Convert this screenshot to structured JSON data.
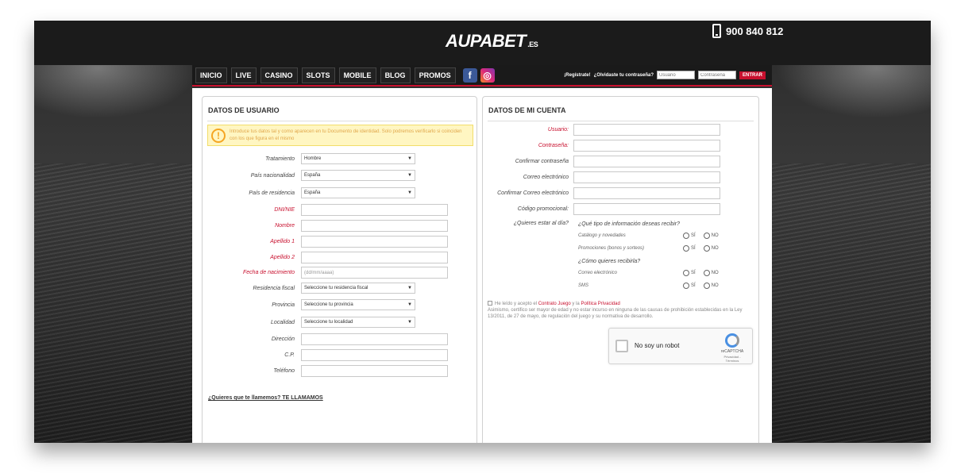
{
  "header": {
    "logo_text": "AUPABET",
    "logo_suffix": ".ES",
    "phone": "900 840 812"
  },
  "nav": {
    "items": [
      "INICIO",
      "LIVE",
      "CASINO",
      "SLOTS",
      "MOBILE",
      "BLOG",
      "PROMOS"
    ],
    "register_link": "¡Regístrate!",
    "forgot_link": "¿Olvidaste tu contraseña?",
    "username_placeholder": "Usuario",
    "password_placeholder": "Contraseña",
    "login_button": "ENTRAR"
  },
  "user_panel": {
    "title": "DATOS DE USUARIO",
    "warning": "Introduce tus datos tal y como aparecen en tu Documento de identidad. Solo podremos verificarlo si coinciden con los que figura en el mismo",
    "fields": [
      {
        "label": "Tratamiento",
        "type": "select",
        "value": "Hombre",
        "required": false
      },
      {
        "label": "País nacionalidad",
        "type": "select",
        "value": "España",
        "required": false
      },
      {
        "label": "País de residencia",
        "type": "select",
        "value": "España",
        "required": false
      },
      {
        "label": "DNI/NIE",
        "type": "text",
        "value": "",
        "required": true
      },
      {
        "label": "Nombre",
        "type": "text",
        "value": "",
        "required": true
      },
      {
        "label": "Apellido 1",
        "type": "text",
        "value": "",
        "required": true
      },
      {
        "label": "Apellido 2",
        "type": "text",
        "value": "",
        "required": true
      },
      {
        "label": "Fecha de nacimiento",
        "type": "text",
        "value": "(dd/mm/aaaa)",
        "required": true
      },
      {
        "label": "Residencia fiscal",
        "type": "select",
        "value": "Seleccione tu residencia fiscal",
        "required": false
      },
      {
        "label": "Provincia",
        "type": "select",
        "value": "Seleccione tu provincia",
        "required": false
      },
      {
        "label": "Localidad",
        "type": "select",
        "value": "Seleccione tu localidad",
        "required": false
      },
      {
        "label": "Dirección",
        "type": "text",
        "value": "",
        "required": false
      },
      {
        "label": "C.P.",
        "type": "text",
        "value": "",
        "required": false
      },
      {
        "label": "Teléfono",
        "type": "text",
        "value": "",
        "required": false
      }
    ],
    "call_link": "¿Quieres que te llamemos? TE LLAMAMOS"
  },
  "account_panel": {
    "title": "DATOS DE MI CUENTA",
    "fields": [
      {
        "label": "Usuario:",
        "required": true
      },
      {
        "label": "Contraseña:",
        "required": true
      },
      {
        "label": "Confirmar contraseña",
        "required": false
      },
      {
        "label": "Correo electrónico",
        "required": false
      },
      {
        "label": "Confirmar Correo electrónico",
        "required": false
      },
      {
        "label": "Código promocional:",
        "required": false
      }
    ],
    "stay_label": "¿Quieres estar al día?",
    "info_question": "¿Qué tipo de información deseas recibir?",
    "info_options": [
      "Catálogo y novedades",
      "Promociones (bonos y sorteos)"
    ],
    "channel_question": "¿Cómo quieres recibirla?",
    "channel_options": [
      "Correo electrónico",
      "SMS"
    ],
    "yes_label": "SÍ",
    "no_label": "NO",
    "legal_prefix": "He leído y acepto el",
    "legal_link1": "Contrato Juego",
    "legal_and": "y la",
    "legal_link2": "Política Privacidad",
    "legal_text": "Asimismo, certifico ser mayor de edad y no estar incurso en ninguna de las causas de prohibición establecidas en la Ley 13/2011, de 27 de mayo, de regulación del juego y su normativa de desarrollo.",
    "captcha_label": "No soy un robot",
    "captcha_brand": "reCAPTCHA",
    "captcha_links": "Privacidad - Términos"
  }
}
